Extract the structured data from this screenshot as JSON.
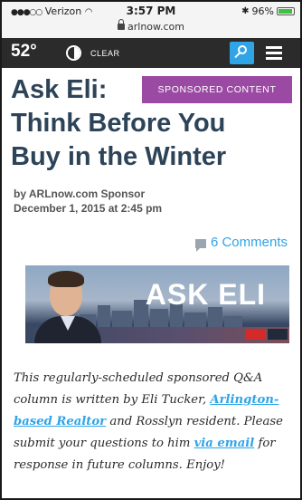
{
  "status_bar": {
    "signal": "●●●○○",
    "carrier": "Verizon",
    "wifi_icon": "wifi-icon",
    "time": "3:57 PM",
    "bluetooth_icon": "bluetooth-icon",
    "battery": "96%",
    "battery_level": 0.96,
    "url": "arlnow.com"
  },
  "site_header": {
    "temperature": "52°",
    "condition": "CLEAR",
    "accent": "#2fa4e7",
    "background": "#2b2b2b"
  },
  "article": {
    "badge": "SPONSORED CONTENT",
    "badge_color": "#9b4aa3",
    "title_lines": [
      "Ask Eli:",
      "Think Before You",
      "Buy in the Winter"
    ],
    "byline": "by ARLnow.com Sponsor",
    "date": "December 1, 2015 at 2:45 pm",
    "comments": "6 Comments",
    "banner_text": "ASK ELI",
    "intro_1": "This regularly-scheduled sponsored Q&A column is written by Eli Tucker, ",
    "intro_link_1": "Arlington-based Realtor",
    "intro_2": " and Rosslyn resident. Please submit your questions to him ",
    "intro_link_2": "via email",
    "intro_3": " for response in future columns. Enjoy!"
  }
}
